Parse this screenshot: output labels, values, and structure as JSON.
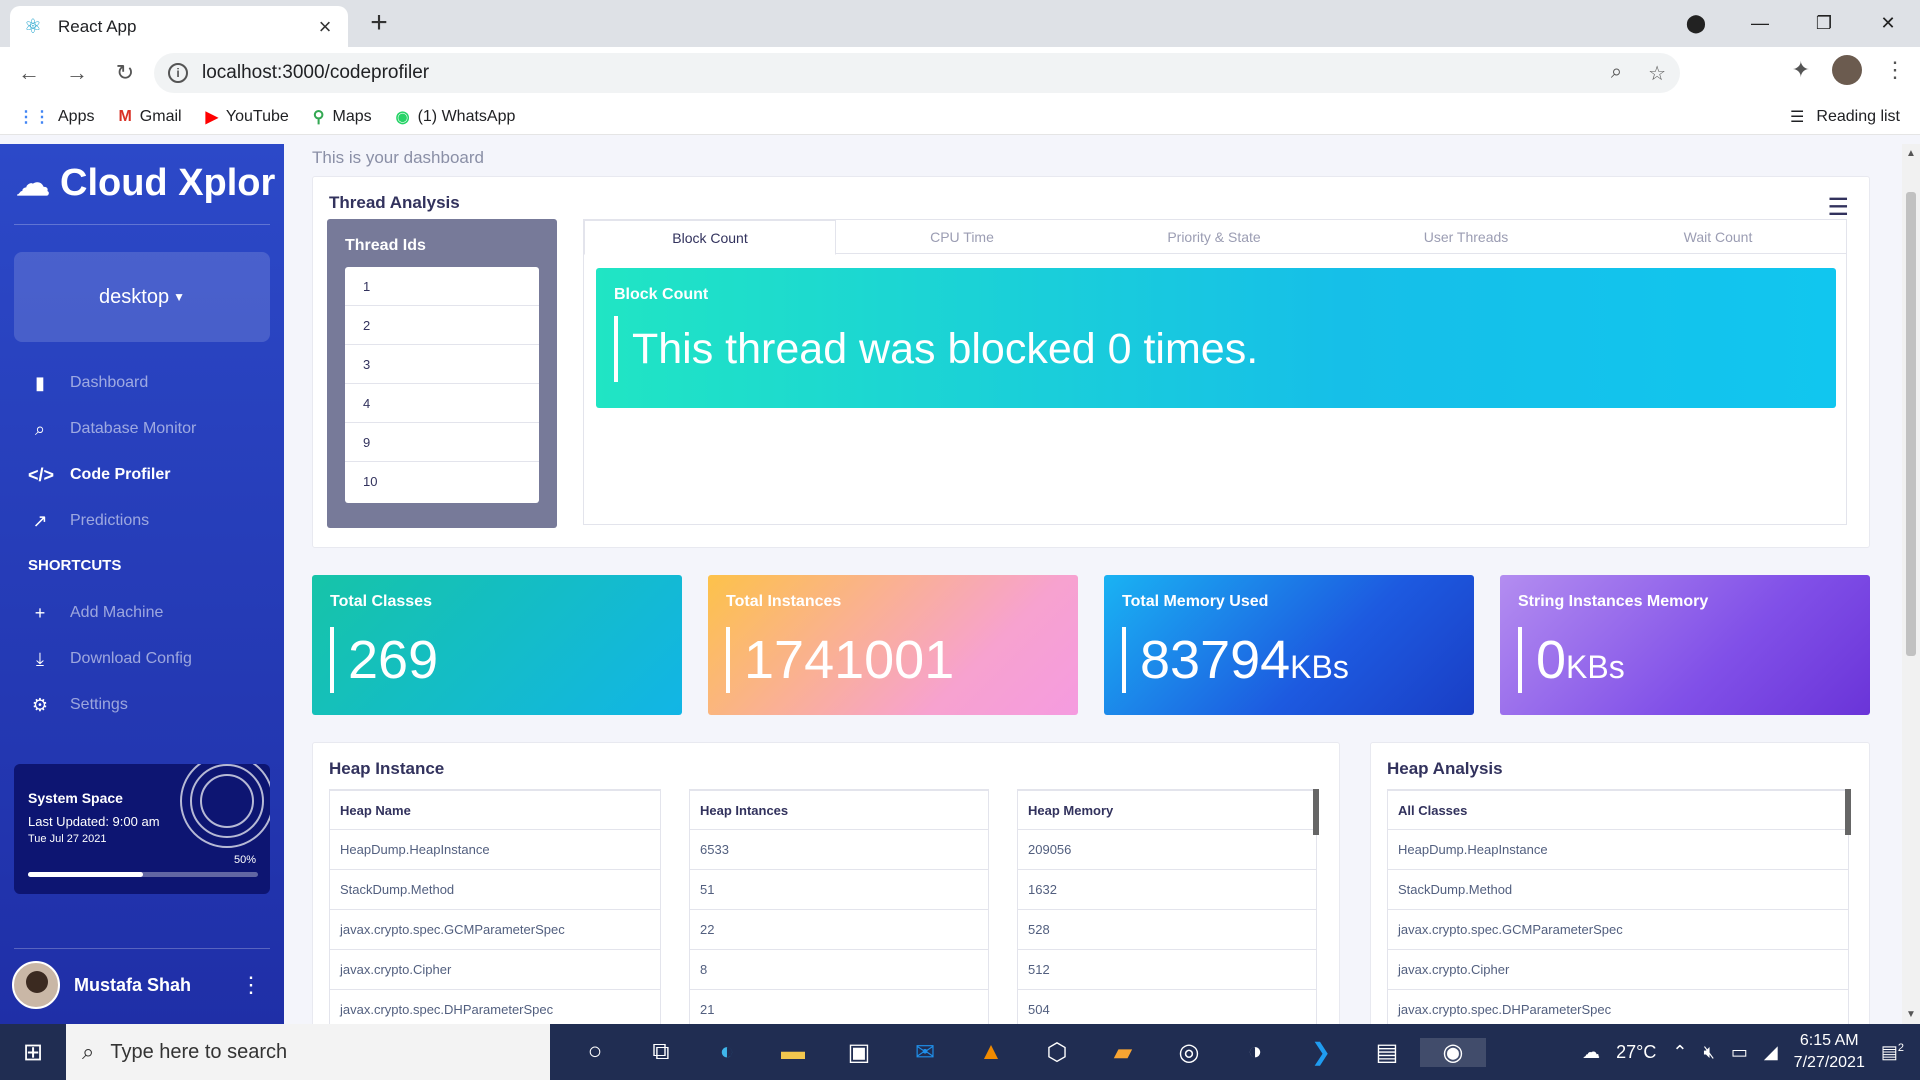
{
  "browser": {
    "tab_title": "React App",
    "url": "localhost:3000/codeprofiler",
    "bookmarks": [
      "Apps",
      "Gmail",
      "YouTube",
      "Maps",
      "(1) WhatsApp"
    ],
    "reading_list": "Reading list"
  },
  "sidebar": {
    "brand": "Cloud Xplor",
    "machine": "desktop",
    "nav": [
      "Dashboard",
      "Database Monitor",
      "Code Profiler",
      "Predictions"
    ],
    "active_nav": "Code Profiler",
    "shortcuts_label": "SHORTCUTS",
    "shortcuts": [
      "Add Machine",
      "Download Config",
      "Settings"
    ],
    "system": {
      "title": "System Space",
      "updated": "Last Updated: 9:00 am",
      "date": "Tue Jul 27 2021",
      "percent_label": "50%",
      "percent": 0.5
    },
    "user": "Mustafa Shah"
  },
  "main": {
    "subtitle": "This is your dashboard",
    "thread": {
      "title": "Thread Analysis",
      "ids_title": "Thread Ids",
      "ids": [
        "1",
        "2",
        "3",
        "4",
        "9",
        "10"
      ],
      "tabs": [
        "Block Count",
        "CPU Time",
        "Priority & State",
        "User Threads",
        "Wait Count"
      ],
      "active_tab": "Block Count",
      "block_title": "Block Count",
      "block_text": "This thread was blocked 0 times."
    },
    "stats": [
      {
        "title": "Total Classes",
        "value": "269",
        "unit": ""
      },
      {
        "title": "Total Instances",
        "value": "1741001",
        "unit": ""
      },
      {
        "title": "Total Memory Used",
        "value": "83794",
        "unit": "KBs"
      },
      {
        "title": "String Instances Memory",
        "value": "0",
        "unit": "KBs"
      }
    ],
    "heap_instance": {
      "title": "Heap Instance",
      "headers": [
        "Heap Name",
        "Heap Intances",
        "Heap Memory"
      ],
      "rows": [
        [
          "HeapDump.HeapInstance",
          "6533",
          "209056"
        ],
        [
          "StackDump.Method",
          "51",
          "1632"
        ],
        [
          "javax.crypto.spec.GCMParameterSpec",
          "22",
          "528"
        ],
        [
          "javax.crypto.Cipher",
          "8",
          "512"
        ],
        [
          "javax.crypto.spec.DHParameterSpec",
          "21",
          "504"
        ]
      ]
    },
    "heap_analysis": {
      "title": "Heap Analysis",
      "header": "All Classes",
      "rows": [
        "HeapDump.HeapInstance",
        "StackDump.Method",
        "javax.crypto.spec.GCMParameterSpec",
        "javax.crypto.Cipher",
        "javax.crypto.spec.DHParameterSpec"
      ]
    }
  },
  "taskbar": {
    "search_placeholder": "Type here to search",
    "weather": "27°C",
    "time": "6:15 AM",
    "date": "7/27/2021",
    "notifications": "2"
  }
}
